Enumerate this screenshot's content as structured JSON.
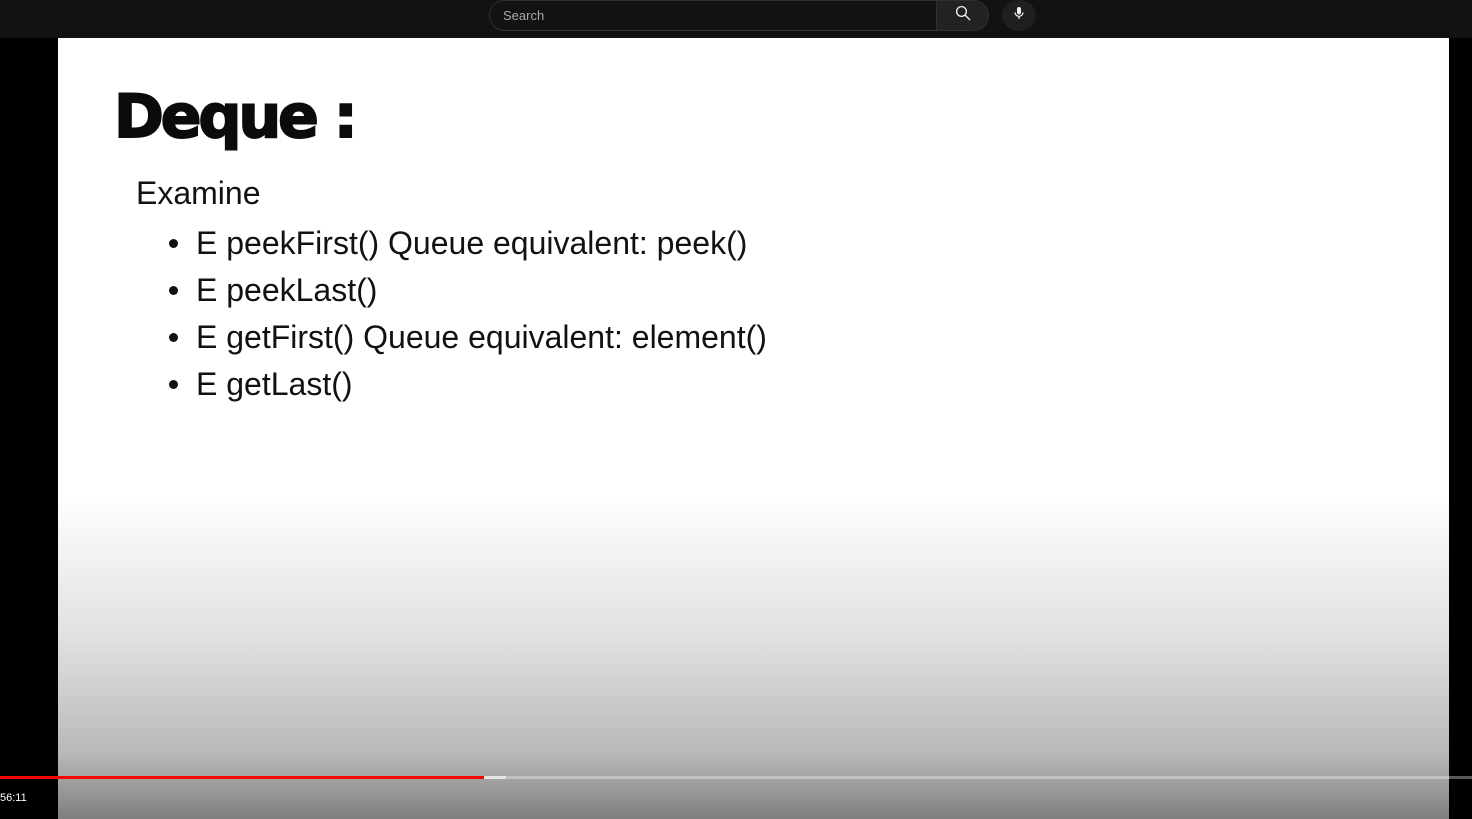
{
  "header": {
    "search_placeholder": "Search",
    "search_icon": "search-icon",
    "mic_icon": "microphone-icon"
  },
  "slide": {
    "title": "Deque :",
    "subhead": "Examine",
    "bullets": [
      "E peekFirst() Queue equivalent: peek()",
      "E peekLast()",
      "E getFirst() Queue equivalent: element()",
      "E getLast()"
    ]
  },
  "player": {
    "time": "56:11",
    "played_fraction": 0.329,
    "progress_color": "#ff0000"
  }
}
